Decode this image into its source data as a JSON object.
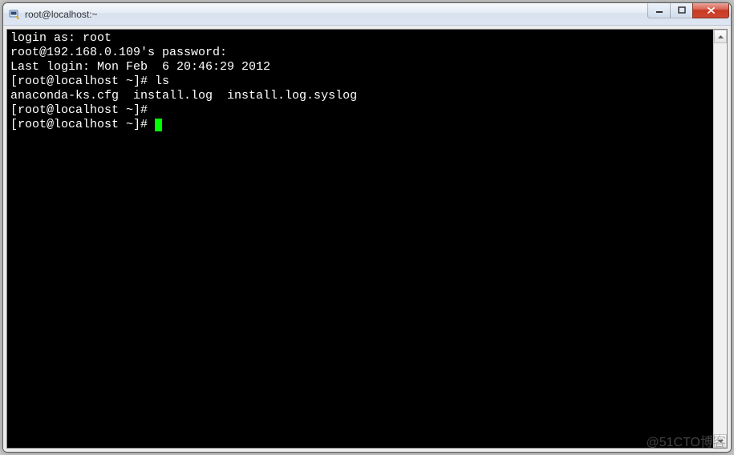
{
  "window": {
    "title": "root@localhost:~"
  },
  "terminal": {
    "lines": [
      "login as: root",
      "root@192.168.0.109's password:",
      "Last login: Mon Feb  6 20:46:29 2012",
      "[root@localhost ~]# ls",
      "anaconda-ks.cfg  install.log  install.log.syslog",
      "[root@localhost ~]#",
      "[root@localhost ~]# "
    ],
    "cursor_on_last": true
  },
  "watermark": "@51CTO博客"
}
